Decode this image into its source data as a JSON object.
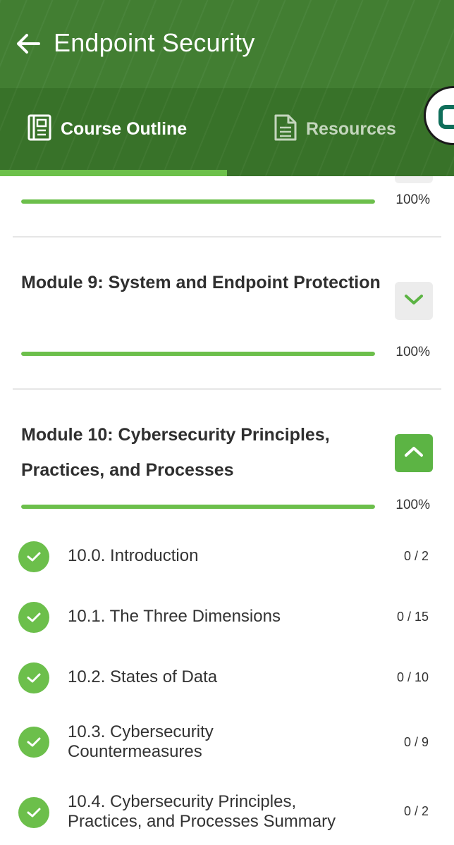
{
  "header": {
    "title": "Endpoint Security",
    "colors": {
      "header_bg": "#3c7a2c",
      "accent": "#6cbf4b"
    }
  },
  "tabs": [
    {
      "label": "Course Outline",
      "icon": "book-icon",
      "active": true
    },
    {
      "label": "Resources",
      "icon": "document-icon",
      "active": false
    }
  ],
  "modules": [
    {
      "title": "",
      "progress_percent": 100,
      "progress_label": "100%"
    },
    {
      "title": "Module 9: System and Endpoint Protection",
      "progress_percent": 100,
      "progress_label": "100%",
      "toggle_icon": "chevron-down-icon",
      "expanded": false
    },
    {
      "title": "Module 10: Cybersecurity Principles, Practices, and Processes",
      "progress_percent": 100,
      "progress_label": "100%",
      "toggle_icon": "chevron-up-icon",
      "expanded": true,
      "lessons": [
        {
          "title": "10.0. Introduction",
          "count": "0 / 2",
          "icon": "checkmark-icon"
        },
        {
          "title": "10.1. The Three Dimensions",
          "count": "0 / 15",
          "icon": "checkmark-icon"
        },
        {
          "title": "10.2. States of Data",
          "count": "0 / 10",
          "icon": "checkmark-icon"
        },
        {
          "title": "10.3. Cybersecurity Countermeasures",
          "count": "0 / 9",
          "icon": "checkmark-icon"
        },
        {
          "title": "10.4. Cybersecurity Principles, Practices, and Processes Summary",
          "count": "0 / 2",
          "icon": "checkmark-icon"
        }
      ]
    }
  ]
}
